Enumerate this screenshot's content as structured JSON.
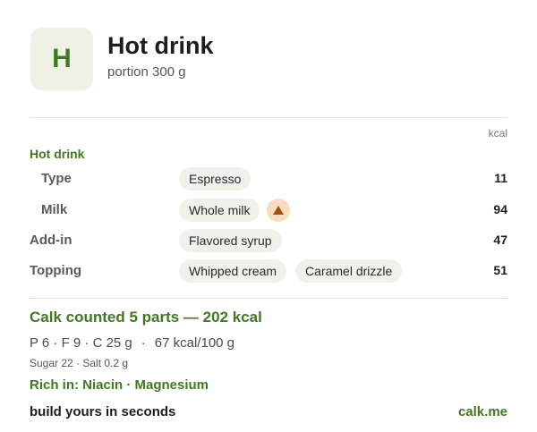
{
  "header": {
    "logo_letter": "H",
    "title": "Hot drink",
    "portion": "portion 300 g"
  },
  "table": {
    "kcal_header": "kcal",
    "section_label": "Hot drink",
    "rows": [
      {
        "label": "Type",
        "chips": [
          "Espresso"
        ],
        "kcal": "11"
      },
      {
        "label": "Milk",
        "chips": [
          "Whole milk"
        ],
        "warning_icon": "warning-triangle-icon",
        "kcal": "94"
      },
      {
        "label": "Add-in",
        "chips": [
          "Flavored syrup"
        ],
        "kcal": "47"
      },
      {
        "label": "Topping",
        "chips": [
          "Whipped cream",
          "Caramel drizzle"
        ],
        "kcal": "51"
      }
    ]
  },
  "summary": {
    "headline": "Calk counted 5 parts — 202 kcal",
    "macros": "P 6 · F 9 · C 25 g",
    "per100": "67 kcal/100 g",
    "minor": "Sugar 22 · Salt 0.2 g",
    "rich_in": "Rich in: Niacin · Magnesium"
  },
  "footer": {
    "tagline": "build yours in seconds",
    "site": "calk.me"
  },
  "colors": {
    "accent_green": "#3f7a20",
    "logo_bg": "#eef1e3",
    "chip_bg": "#f1f1ec",
    "warning_bg": "#f7dcc0",
    "warning_icon": "#a4500e"
  }
}
